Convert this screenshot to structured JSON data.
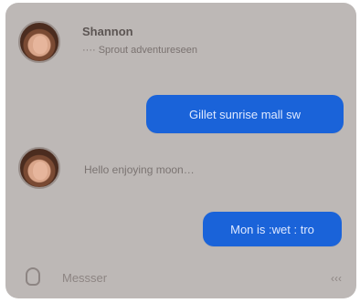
{
  "conversation": {
    "sender_name": "Shannon",
    "subtitle": "···· Sprout adventureseen",
    "messages": [
      {
        "direction": "outgoing",
        "text": "Gillet sunrise mall sw"
      },
      {
        "direction": "incoming",
        "text": "Hello enjoying moon…"
      },
      {
        "direction": "outgoing",
        "text": "Mon is :wet : tro"
      }
    ],
    "composer": {
      "placeholder": "Messser",
      "right_label": "‹‹‹"
    }
  },
  "colors": {
    "card_bg": "#bdb8b6",
    "bubble_blue": "#1a63d9"
  },
  "icons": {
    "mic": "mic-icon"
  }
}
